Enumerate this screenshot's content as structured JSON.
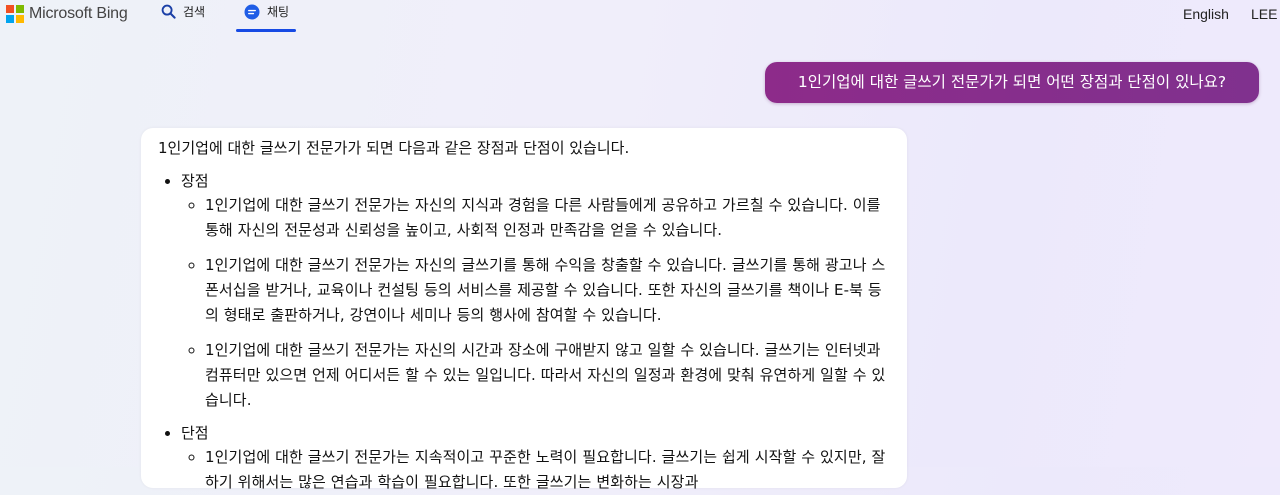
{
  "header": {
    "brand": "Microsoft Bing",
    "brand_colors": [
      "#f25022",
      "#7fba00",
      "#00a4ef",
      "#ffb900"
    ],
    "nav": [
      {
        "label": "검색",
        "icon": "search-icon"
      },
      {
        "label": "채팅",
        "icon": "chat-icon",
        "active": true
      }
    ],
    "accent": "#174ae4",
    "language": "English",
    "user": "LEE"
  },
  "conversation": {
    "user_message": "1인기업에 대한 글쓰기 전문가가 되면 어떤 장점과 단점이 있나요?",
    "user_bubble_color": "#8d2b8a",
    "answer": {
      "intro": "1인기업에 대한 글쓰기 전문가가 되면 다음과 같은 장점과 단점이 있습니다.",
      "sections": [
        {
          "title": "장점",
          "items": [
            "1인기업에 대한 글쓰기 전문가는 자신의 지식과 경험을 다른 사람들에게 공유하고 가르칠 수 있습니다. 이를 통해 자신의 전문성과 신뢰성을 높이고, 사회적 인정과 만족감을 얻을 수 있습니다.",
            "1인기업에 대한 글쓰기 전문가는 자신의 글쓰기를 통해 수익을 창출할 수 있습니다. 글쓰기를 통해 광고나 스폰서십을 받거나, 교육이나 컨설팅 등의 서비스를 제공할 수 있습니다. 또한 자신의 글쓰기를 책이나 E-북 등의 형태로 출판하거나, 강연이나 세미나 등의 행사에 참여할 수 있습니다.",
            "1인기업에 대한 글쓰기 전문가는 자신의 시간과 장소에 구애받지 않고 일할 수 있습니다. 글쓰기는 인터넷과 컴퓨터만 있으면 언제 어디서든 할 수 있는 일입니다. 따라서 자신의 일정과 환경에 맞춰 유연하게 일할 수 있습니다."
          ]
        },
        {
          "title": "단점",
          "items": [
            "1인기업에 대한 글쓰기 전문가는 지속적이고 꾸준한 노력이 필요합니다. 글쓰기는 쉽게 시작할 수 있지만, 잘하기 위해서는 많은 연습과 학습이 필요합니다. 또한 글쓰기는 변화하는 시장과"
          ]
        }
      ]
    }
  }
}
